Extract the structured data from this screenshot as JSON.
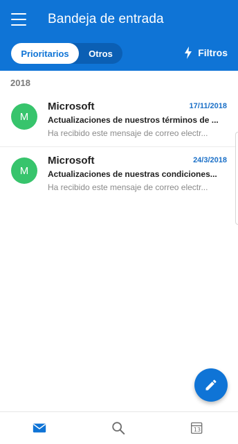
{
  "header": {
    "title": "Bandeja de entrada",
    "tabs": [
      {
        "label": "Prioritarios",
        "active": true
      },
      {
        "label": "Otros",
        "active": false
      }
    ],
    "filters_label": "Filtros",
    "color": "#0f74d6"
  },
  "list": {
    "section_year": "2018",
    "items": [
      {
        "avatar_initial": "M",
        "avatar_color": "#37c46c",
        "sender": "Microsoft",
        "date": "17/11/2018",
        "subject": "Actualizaciones de nuestros términos de ...",
        "preview": "Ha recibido este mensaje de correo electr..."
      },
      {
        "avatar_initial": "M",
        "avatar_color": "#37c46c",
        "sender": "Microsoft",
        "date": "24/3/2018",
        "subject": "Actualizaciones de nuestras condiciones...",
        "preview": "Ha recibido este mensaje de correo electr..."
      }
    ]
  },
  "fab": {
    "icon": "pencil-icon"
  },
  "bottom_nav": {
    "items": [
      {
        "icon": "mail-icon",
        "active": true
      },
      {
        "icon": "search-icon",
        "active": false
      },
      {
        "icon": "calendar-icon",
        "active": false,
        "day": "13"
      }
    ]
  }
}
